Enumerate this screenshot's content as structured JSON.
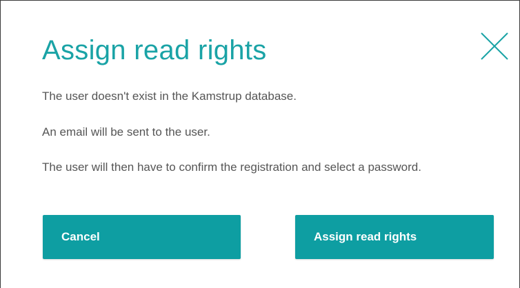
{
  "dialog": {
    "title": "Assign read rights",
    "close_icon": "close-icon",
    "messages": [
      "The user doesn't exist in the Kamstrup database.",
      "An email will be sent to the user.",
      "The user will then have to confirm the registration and select a password."
    ],
    "buttons": {
      "cancel_label": "Cancel",
      "assign_label": "Assign read rights"
    }
  },
  "colors": {
    "accent": "#1aa3a6",
    "button_bg": "#0e9ea2",
    "text": "#555555"
  }
}
